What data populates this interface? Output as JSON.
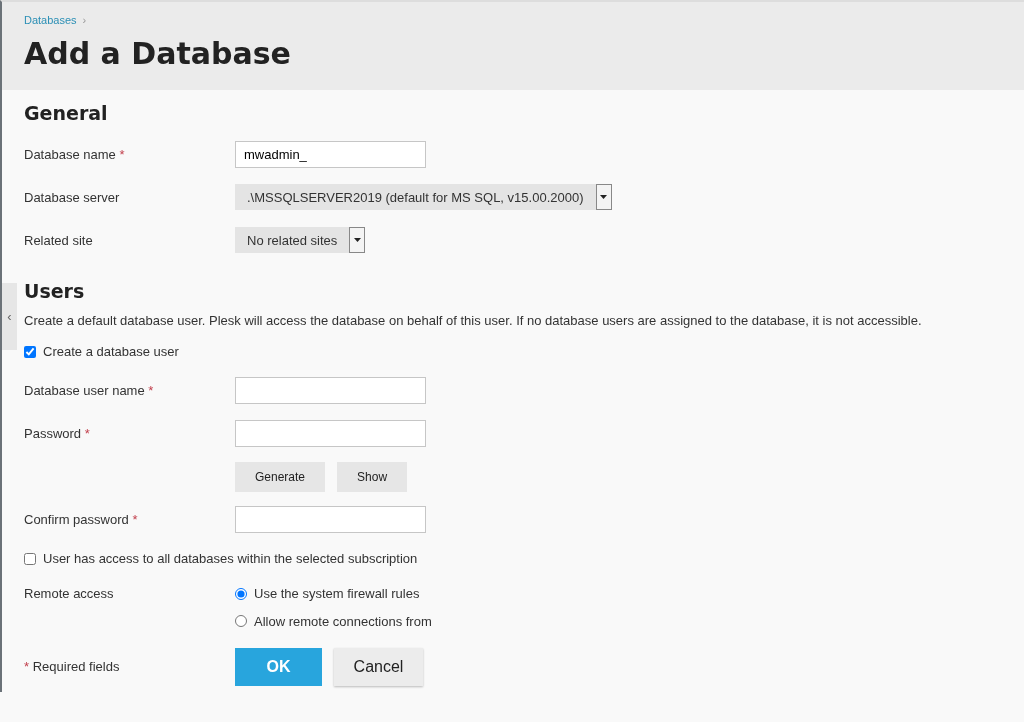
{
  "breadcrumb": {
    "items": [
      "Databases"
    ],
    "separator": "›"
  },
  "page_title": "Add a Database",
  "sidebar_toggle": {
    "glyph": "‹"
  },
  "sections": [
    {
      "title": "General",
      "fields": [
        {
          "kind": "text",
          "label": "Database name",
          "required_mark": "*",
          "value": "mwadmin_"
        },
        {
          "kind": "select",
          "label": "Database server",
          "value": ".\\MSSQLSERVER2019 (default for MS SQL, v15.00.2000)"
        },
        {
          "kind": "select",
          "label": "Related site",
          "value": "No related sites"
        }
      ]
    },
    {
      "title": "Users",
      "description": "Create a default database user. Plesk will access the database on behalf of this user. If no database users are assigned to the database, it is not accessible.",
      "fields": [
        {
          "kind": "checkbox",
          "label": "Create a database user",
          "checked": true
        },
        {
          "kind": "text",
          "label": "Database user name",
          "required_mark": "*"
        },
        {
          "kind": "text",
          "label": "Password",
          "required_mark": "*"
        },
        {
          "kind": "buttons",
          "buttons": [
            "Generate",
            "Show"
          ]
        },
        {
          "kind": "text",
          "label": "Confirm password",
          "required_mark": "*"
        },
        {
          "kind": "checkbox",
          "label": "User has access to all databases within the selected subscription",
          "checked": false
        },
        {
          "kind": "radio",
          "label": "Remote access",
          "options": [
            {
              "label": "Use the system firewall rules",
              "selected": true
            },
            {
              "label": "Allow remote connections from",
              "selected": false
            }
          ]
        }
      ]
    }
  ],
  "footer": {
    "note_mark": "*",
    "note": "Required fields",
    "buttons": [
      {
        "label": "OK",
        "primary": true
      },
      {
        "label": "Cancel",
        "primary": false
      }
    ]
  }
}
